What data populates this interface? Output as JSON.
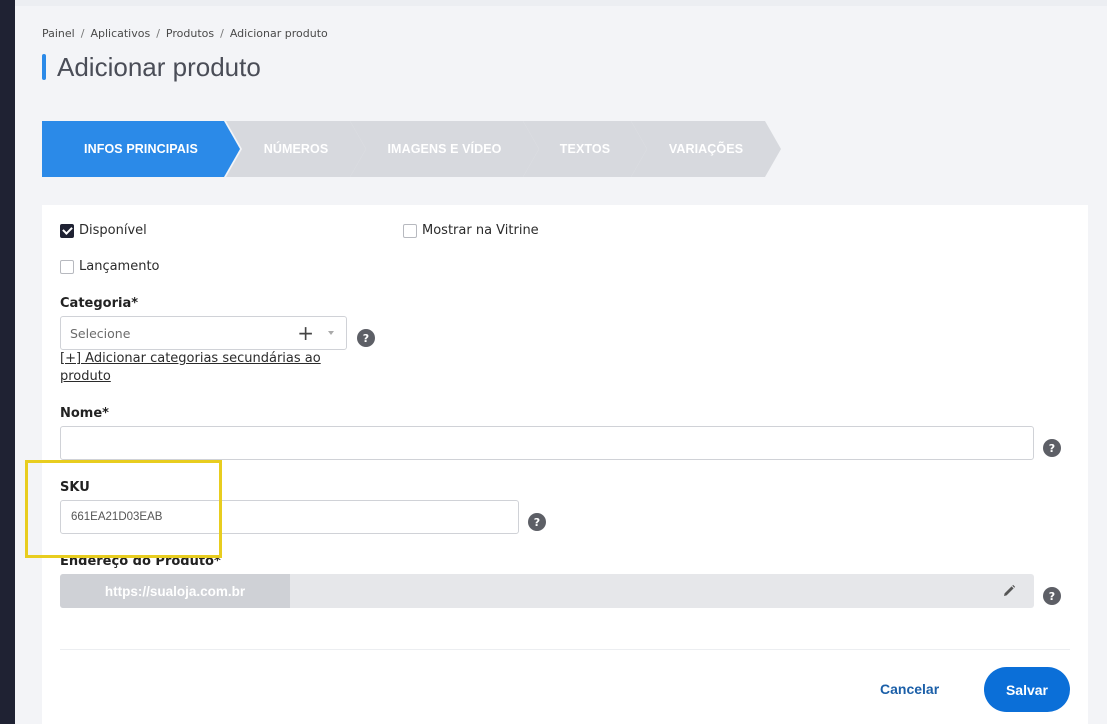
{
  "breadcrumb": [
    "Painel",
    "Aplicativos",
    "Produtos",
    "Adicionar produto"
  ],
  "page_title": "Adicionar produto",
  "steps": [
    "INFOS PRINCIPAIS",
    "NÚMEROS",
    "IMAGENS E VÍDEO",
    "TEXTOS",
    "VARIAÇÕES"
  ],
  "form": {
    "disponivel": "Disponível",
    "vitrine": "Mostrar na Vitrine",
    "lancamento": "Lançamento",
    "categoria_label": "Categoria*",
    "categoria_placeholder": "Selecione",
    "categoria_plus": "+",
    "secundarias_link_line1": "[+] Adicionar categorias secundárias ao",
    "secundarias_link_line2": "produto",
    "nome_label": "Nome*",
    "nome_value": "",
    "sku_label": "SKU",
    "sku_value": "661EA21D03EAB",
    "endereco_label": "Endereço do Produto*",
    "endereco_prefix": "https://sualoja.com.br",
    "help": "?"
  },
  "actions": {
    "cancel": "Cancelar",
    "save": "Salvar"
  },
  "colors": {
    "accent": "#2b8ae8",
    "save": "#0b6fd8",
    "highlight": "#e8cd1f",
    "rail": "#1f2233"
  }
}
